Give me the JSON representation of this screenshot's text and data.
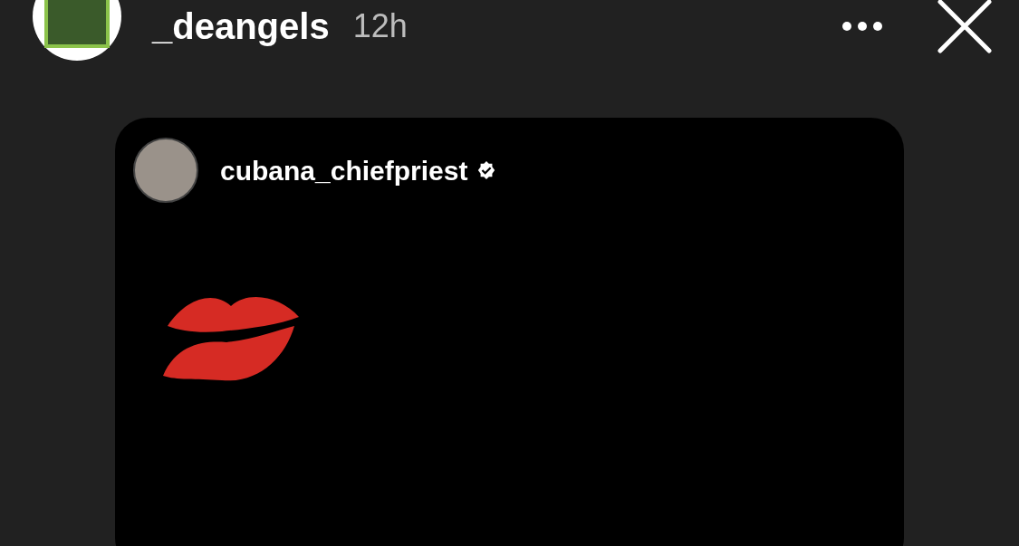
{
  "header": {
    "username": "_deangels",
    "time": "12h"
  },
  "post": {
    "username": "cubana_chiefpriest",
    "verified": true
  }
}
